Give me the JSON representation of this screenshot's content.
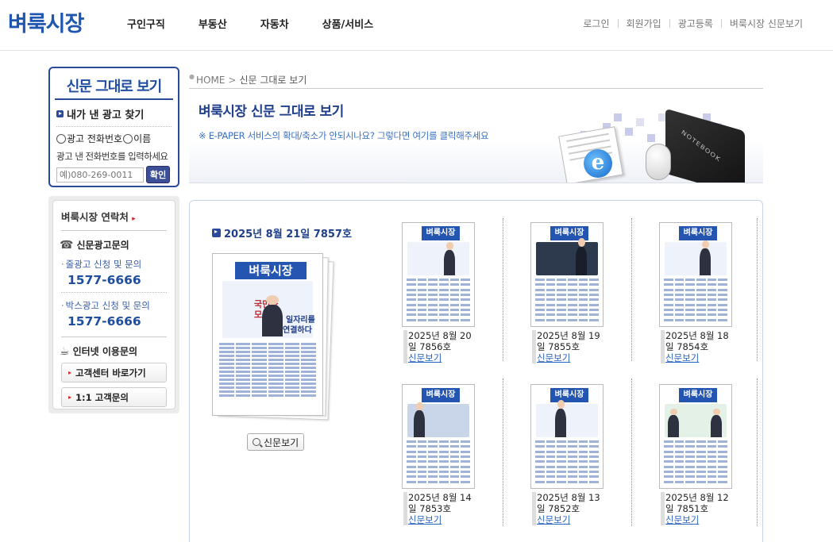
{
  "header": {
    "logo": "벼룩시장",
    "nav": [
      "구인구직",
      "부동산",
      "자동차",
      "상품/서비스"
    ],
    "util": [
      "로그인",
      "회원가입",
      "광고등록",
      "벼룩시장 신문보기"
    ]
  },
  "search_box": {
    "title": "신문 그대로 보기",
    "subtitle": "내가 낸 광고 찾기",
    "radio_phone": "광고 전화번호",
    "radio_name": "이름",
    "hint": "광고 낸 전화번호를 입력하세요",
    "input_placeholder": "예)080-269-0011",
    "confirm": "확인"
  },
  "contact": {
    "title": "벼룩시장 연락처",
    "arrow": "▸",
    "ad_section": "신문광고문의",
    "line_ad_label": "줄광고 신청 및 문의",
    "line_ad_number": "1577-6666",
    "box_ad_label": "박스광고 신청 및 문의",
    "box_ad_number": "1577-6666",
    "internet_section": "인터넷 이용문의",
    "btn_center": "고객센터 바로가기",
    "btn_qna": "1:1 고객문의"
  },
  "breadcrumb": {
    "home": "HOME",
    "current": "신문 그대로 보기"
  },
  "banner": {
    "title": "벼룩시장 신문 그대로 보기",
    "desc": "※ E-PAPER 서비스의 확대/축소가 안되시나요? 그렇다면 여기를 클릭해주세요",
    "laptop_text": "NOTEBOOK"
  },
  "latest": {
    "title": "2025년 8월 21일 7857호",
    "masthead": "벼룩시장",
    "headline_1": "국민과",
    "headline_2": "모든",
    "headline_3": "일자리를",
    "headline_4": "연결하다",
    "view_label": "신문보기"
  },
  "issues": [
    {
      "date": "2025년 8월 20",
      "no": "일 7856호",
      "masthead": "벼룩시장",
      "link": "신문보기"
    },
    {
      "date": "2025년 8월 19",
      "no": "일 7855호",
      "masthead": "벼룩시장",
      "link": "신문보기"
    },
    {
      "date": "2025년 8월 18",
      "no": "일 7854호",
      "masthead": "벼룩시장",
      "link": "신문보기"
    },
    {
      "date": "2025년 8월 14",
      "no": "일 7853호",
      "masthead": "벼룩시장",
      "link": "신문보기"
    },
    {
      "date": "2025년 8월 13",
      "no": "일 7852호",
      "masthead": "벼룩시장",
      "link": "신문보기"
    },
    {
      "date": "2025년 8월 12",
      "no": "일 7851호",
      "masthead": "벼룩시장",
      "link": "신문보기"
    }
  ],
  "colors": {
    "brand": "#1f56b0",
    "navy": "#2a4a9b",
    "link": "#2a62c0"
  }
}
